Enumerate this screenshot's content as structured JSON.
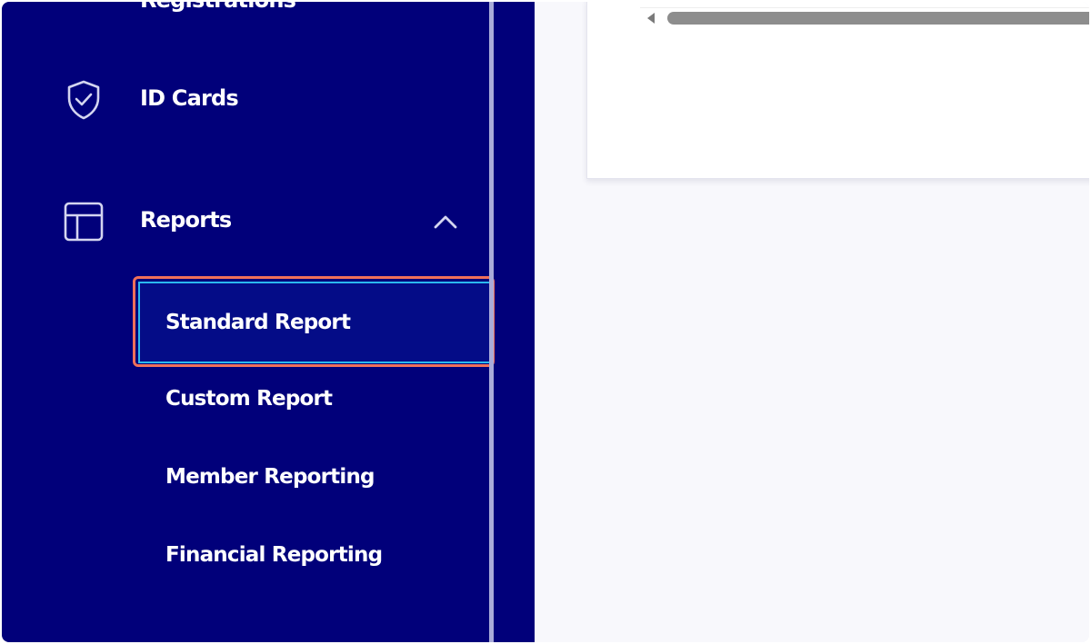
{
  "sidebar": {
    "partial_item": {
      "label": "Registrations",
      "icon": "pin-icon"
    },
    "items": [
      {
        "label": "ID Cards",
        "icon": "shield-check-icon"
      },
      {
        "label": "Reports",
        "icon": "layout-icon",
        "expanded": true,
        "toggle_icon": "chevron-up-icon"
      }
    ],
    "report_subitems": [
      {
        "label": "Standard Report",
        "active": true
      },
      {
        "label": "Custom Report",
        "active": false
      },
      {
        "label": "Member Reporting",
        "active": false
      },
      {
        "label": "Financial Reporting",
        "active": false
      }
    ]
  },
  "colors": {
    "sidebar_bg": "#01007a",
    "active_item_bg": "#040c87",
    "active_item_border": "#2bb8ee",
    "highlight_border": "#f0705a",
    "content_bg": "#f8f8fc",
    "scroll_thumb": "#8d8d8d"
  }
}
